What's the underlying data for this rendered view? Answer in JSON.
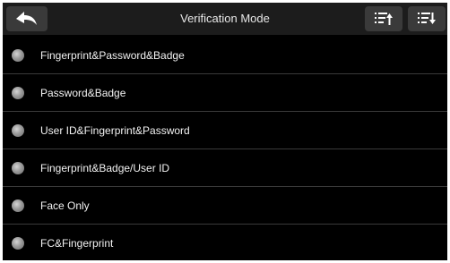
{
  "header": {
    "title": "Verification Mode",
    "back_icon": "back-arrow-icon",
    "sort_ascending_icon": "sort-ascending-icon",
    "sort_descending_icon": "sort-descending-icon"
  },
  "options": [
    {
      "label": "Fingerprint&Password&Badge",
      "selected": false
    },
    {
      "label": "Password&Badge",
      "selected": false
    },
    {
      "label": "User ID&Fingerprint&Password",
      "selected": false
    },
    {
      "label": "Fingerprint&Badge/User ID",
      "selected": false
    },
    {
      "label": "Face Only",
      "selected": false
    },
    {
      "label": "FC&Fingerprint",
      "selected": false
    }
  ],
  "colors": {
    "background": "#000000",
    "header": "#1c1c1c",
    "button": "#3a3a3a",
    "text": "#f2f2f2",
    "divider": "#3a3a3a"
  }
}
